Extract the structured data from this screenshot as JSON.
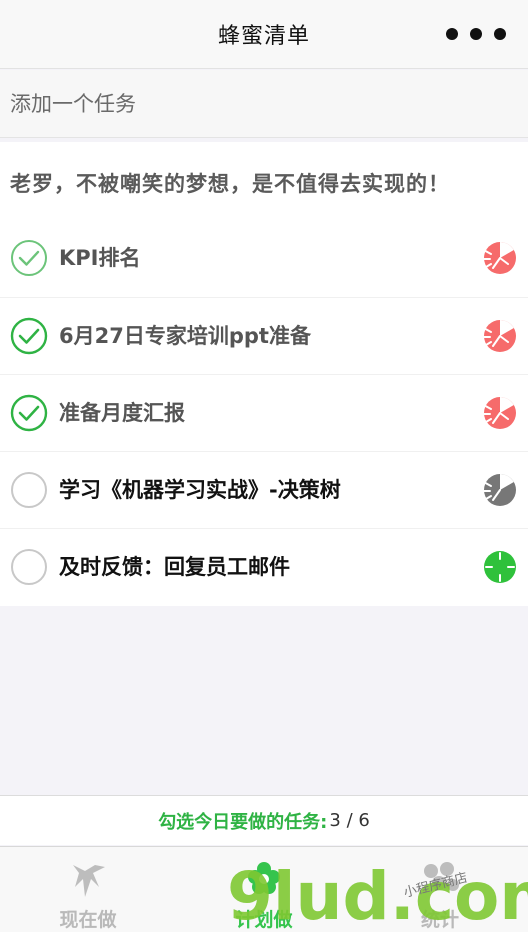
{
  "nav": {
    "title": "蜂蜜清单",
    "more_icon": "more-dots-icon"
  },
  "add_task": {
    "placeholder": "添加一个任务",
    "value": ""
  },
  "motto": "老罗，不被嘲笑的梦想，是不值得去实现的！",
  "tasks": [
    {
      "label": "KPI排名",
      "checked": true,
      "priority_color": "#f66b6b"
    },
    {
      "label": "6月27日专家培训ppt准备",
      "checked": true,
      "priority_color": "#f66b6b"
    },
    {
      "label": "准备月度汇报",
      "checked": true,
      "priority_color": "#f66b6b"
    },
    {
      "label": "学习《机器学习实战》-决策树",
      "checked": false,
      "priority_color": "#777777"
    },
    {
      "label": "及时反馈：回复员工邮件",
      "checked": false,
      "priority_color": "#2fc13b"
    }
  ],
  "status": {
    "label": "勾选今日要做的任务:",
    "count": "3 / 6"
  },
  "tabs": [
    {
      "label": "现在做",
      "icon": "swallow-icon",
      "active": false
    },
    {
      "label": "计划做",
      "icon": "flower-icon",
      "active": true
    },
    {
      "label": "统计",
      "icon": "chart-icon",
      "active": false
    }
  ],
  "watermark": {
    "brand": "9lud.com",
    "shop": "小程序商店"
  },
  "colors": {
    "accent": "#35c44d",
    "check": "#2fb344",
    "priority_high": "#f66b6b"
  }
}
